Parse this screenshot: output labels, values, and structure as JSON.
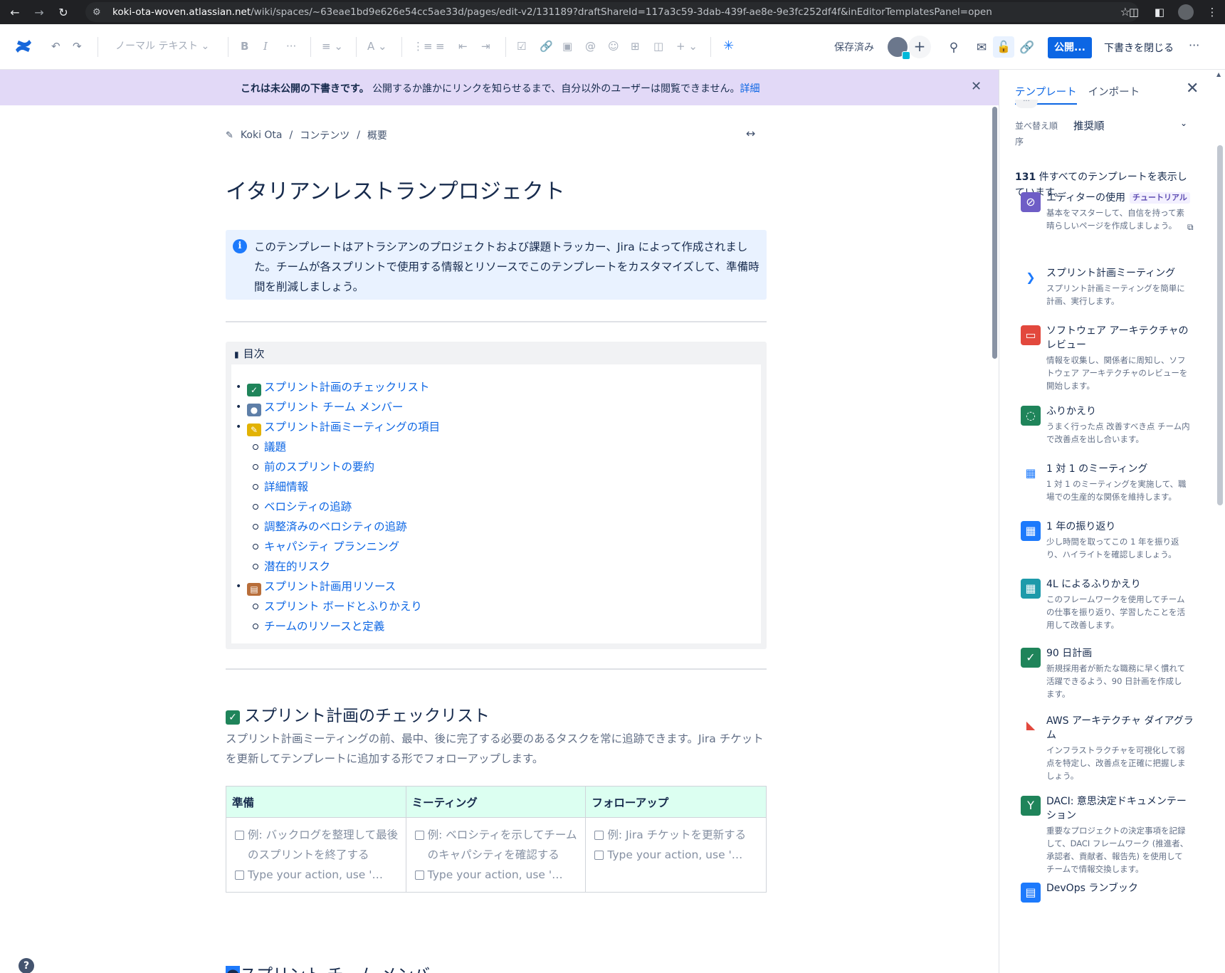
{
  "browser": {
    "url_host": "koki-ota-woven.atlassian.net",
    "url_rest": "/wiki/spaces/~63eae1bd9e626e54cc5ae33d/pages/edit-v2/131189?draftShareId=117a3c59-3dab-439f-ae8e-9e3fc252df4f&inEditorTemplatesPanel=open"
  },
  "toolbar": {
    "text_style": "ノーマル テキスト",
    "saved": "保存済み",
    "publish": "公開...",
    "close_draft": "下書きを閉じる"
  },
  "banner": {
    "bold": "これは未公開の下書きです。",
    "text": "公開するか誰かにリンクを知らせるまで、自分以外のユーザーは閲覧できません。",
    "link": "詳細"
  },
  "breadcrumb": [
    "Koki Ota",
    "コンテンツ",
    "概要"
  ],
  "breadcrumb_sep": "/",
  "page": {
    "title": "イタリアンレストランプロジェクト",
    "info": "このテンプレートはアトラシアンのプロジェクトおよび課題トラッカー、Jira によって作成されました。チームが各スプリントで使用する情報とリソースでこのテンプレートをカスタマイズして、準備時間を削減しましょう。",
    "toc_heading": "目次",
    "toc": [
      {
        "label": "スプリント計画のチェックリスト",
        "level": 1,
        "emoji": "check"
      },
      {
        "label": "スプリント チーム メンバー",
        "level": 1,
        "emoji": "people"
      },
      {
        "label": "スプリント計画ミーティングの項目",
        "level": 1,
        "emoji": "pencil"
      },
      {
        "label": "議題",
        "level": 2
      },
      {
        "label": "前のスプリントの要約",
        "level": 2
      },
      {
        "label": "詳細情報",
        "level": 2
      },
      {
        "label": "ベロシティの追跡",
        "level": 2
      },
      {
        "label": "調整済みのベロシティの追跡",
        "level": 2
      },
      {
        "label": "キャパシティ プランニング",
        "level": 2
      },
      {
        "label": "潜在的リスク",
        "level": 2
      },
      {
        "label": "スプリント計画用リソース",
        "level": 1,
        "emoji": "books"
      },
      {
        "label": "スプリント ボードとふりかえり",
        "level": 2
      },
      {
        "label": "チームのリソースと定義",
        "level": 2
      }
    ],
    "section1_title": "スプリント計画のチェックリスト",
    "section1_desc": "スプリント計画ミーティングの前、最中、後に完了する必要のあるタスクを常に追跡できます。Jira チケットを更新してテンプレートに追加する形でフォローアップします。",
    "table": {
      "headers": [
        "準備",
        "ミーティング",
        "フォローアップ"
      ],
      "cells": [
        [
          "例: バックログを整理して最後のスプリントを終了する",
          "Type your action, use '…"
        ],
        [
          "例: ベロシティを示してチームのキャパシティを確認する",
          "Type your action, use '…"
        ],
        [
          "例: Jira チケットを更新する",
          "Type your action, use '…"
        ]
      ]
    },
    "section2_title": "スプリント チーム メンバー"
  },
  "panel": {
    "tabs": [
      "テンプレート",
      "インポート"
    ],
    "sort_label": "並べ替え順序",
    "sort_value": "推奨順",
    "count_num": "131",
    "count_text": " 件すべてのテンプレートを表示しています。",
    "templates": [
      {
        "title": "エディターの使用",
        "tag": "チュートリアル",
        "desc": "基本をマスターして、自信を持って素晴らしいページを作成しましょう。",
        "icon": "compass-icon",
        "color": "#6e5dc6"
      },
      {
        "title": "スプリント計画ミーティング",
        "desc": "スプリント計画ミーティングを簡単に計画、実行します。",
        "icon": "jira-icon",
        "color": "#ffffff"
      },
      {
        "title": "ソフトウェア アーキテクチャのレビュー",
        "desc": "情報を収集し、関係者に周知し、ソフトウェア アーキテクチャのレビューを開始します。",
        "icon": "monitor-icon",
        "color": "#e2483d"
      },
      {
        "title": "ふりかえり",
        "desc": "うまく行った点 改善すべき点 チーム内で改善点を出し合います。",
        "icon": "chat-icon",
        "color": "#1f845a"
      },
      {
        "title": "1 対 1 のミーティング",
        "desc": "1 対 1 のミーティングを実施して、職場での生産的な関係を維持します。",
        "icon": "meeting-icon",
        "color": "#ffffff"
      },
      {
        "title": "1 年の振り返り",
        "desc": "少し時間を取ってこの 1 年を振り返り、ハイライトを確認しましょう。",
        "icon": "calendar-icon",
        "color": "#1d7afc"
      },
      {
        "title": "4L によるふりかえり",
        "desc": "このフレームワークを使用してチームの仕事を振り返り、学習したことを活用して改善します。",
        "icon": "grid-icon",
        "color": "#1d9aaa"
      },
      {
        "title": "90 日計画",
        "desc": "新規採用者が新たな職務に早く慣れて活躍できるよう、90 日計画を作成します。",
        "icon": "person-check-icon",
        "color": "#1f845a"
      },
      {
        "title": "AWS アーキテクチャ ダイアグラム",
        "desc": "インフラストラクチャを可視化して弱点を特定し、改善点を正確に把握しましょう。",
        "icon": "aws-icon",
        "color": "#ffffff"
      },
      {
        "title": "DACI: 意思決定ドキュメンテーション",
        "desc": "重要なプロジェクトの決定事項を記録して、DACI フレームワーク (推進者、承認者、貢献者、報告先) を使用してチームで情報交換します。",
        "icon": "fork-icon",
        "color": "#1f845a"
      },
      {
        "title": "DevOps ランブック",
        "desc": "",
        "icon": "devops-icon",
        "color": "#1d7afc"
      }
    ]
  },
  "help": "?"
}
